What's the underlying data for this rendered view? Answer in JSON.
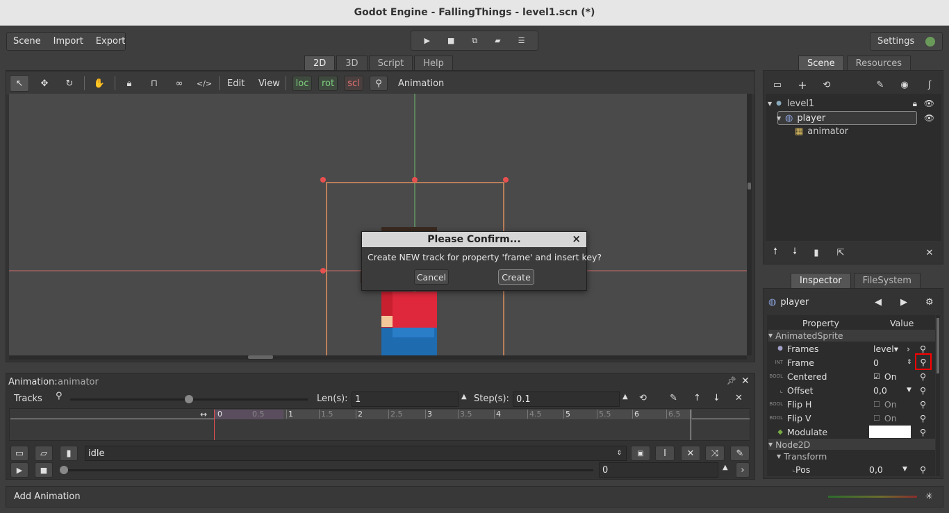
{
  "window": {
    "title": "Godot Engine - FallingThings - level1.scn (*)"
  },
  "menu": {
    "scene": "Scene",
    "import": "Import",
    "export": "Export"
  },
  "settings": {
    "label": "Settings"
  },
  "workspace_tabs": [
    "2D",
    "3D",
    "Script",
    "Help"
  ],
  "toolbar": {
    "edit": "Edit",
    "view": "View",
    "loc": "loc",
    "rot": "rot",
    "scl": "scl",
    "animation": "Animation"
  },
  "dialog": {
    "title": "Please Confirm...",
    "message": "Create NEW track for property 'frame' and insert key?",
    "cancel": "Cancel",
    "create": "Create"
  },
  "scene_dock": {
    "tabs": [
      "Scene",
      "Resources"
    ],
    "tree": [
      {
        "label": "level1"
      },
      {
        "label": "player"
      },
      {
        "label": "animator"
      }
    ]
  },
  "inspector": {
    "tabs": [
      "Inspector",
      "FileSystem"
    ],
    "object": "player",
    "col_property": "Property",
    "col_value": "Value",
    "section1": "AnimatedSprite",
    "rows": [
      {
        "type": "",
        "name": "Frames",
        "value": "level▾"
      },
      {
        "type": "INT",
        "name": "Frame",
        "value": "0"
      },
      {
        "type": "BOOL",
        "name": "Centered",
        "value": "On"
      },
      {
        "type": "",
        "name": "Offset",
        "value": "0,0"
      },
      {
        "type": "BOOL",
        "name": "Flip H",
        "value": "On"
      },
      {
        "type": "BOOL",
        "name": "Flip V",
        "value": "On"
      },
      {
        "type": "",
        "name": "Modulate",
        "value": ""
      }
    ],
    "section2": "Node2D",
    "section3": "Transform",
    "pos": {
      "name": "Pos",
      "value": "0,0"
    },
    "colors": {
      "modulate": "#ffffff",
      "highlight": "#ff0000"
    }
  },
  "animation_panel": {
    "label": "Animation:",
    "node": "animator",
    "tracks": "Tracks",
    "len_label": "Len(s):",
    "len_value": "1",
    "step_label": "Step(s):",
    "step_value": "0.1",
    "timeline": [
      "0",
      "0.5",
      "1",
      "1.5",
      "2",
      "2.5",
      "3",
      "3.5",
      "4",
      "4.5",
      "5",
      "5.5",
      "6",
      "6.5"
    ],
    "current": "idle",
    "position": "0"
  },
  "bottom": {
    "add_animation": "Add Animation"
  }
}
